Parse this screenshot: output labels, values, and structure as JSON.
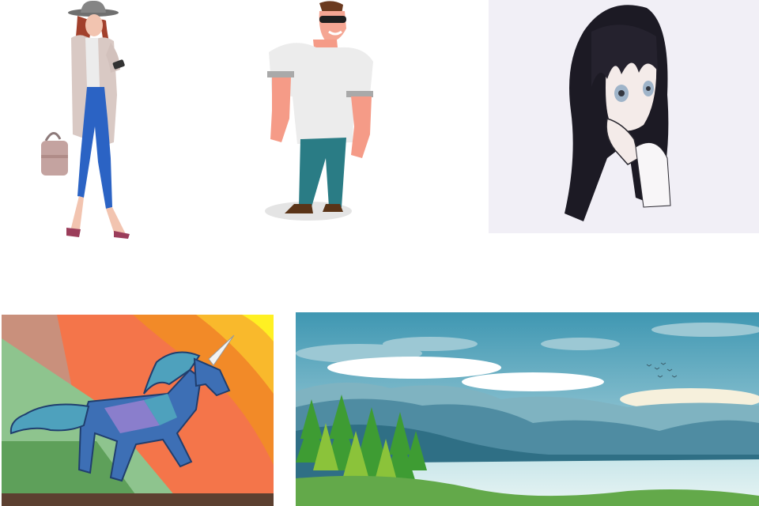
{
  "gallery": {
    "items": [
      {
        "name": "woman-with-phone-illustration"
      },
      {
        "name": "muscular-man-cartoon-illustration"
      },
      {
        "name": "anime-girl-illustration"
      },
      {
        "name": "geometric-unicorn-illustration"
      },
      {
        "name": "mountain-lake-landscape-illustration"
      }
    ]
  },
  "colors": {
    "page_background": "#ffffff",
    "anime_background": "#f1eff6",
    "sky_top": "#3f97b2",
    "sky_bottom": "#c8e3e8",
    "unicorn_blue": "#3d6fb5"
  }
}
